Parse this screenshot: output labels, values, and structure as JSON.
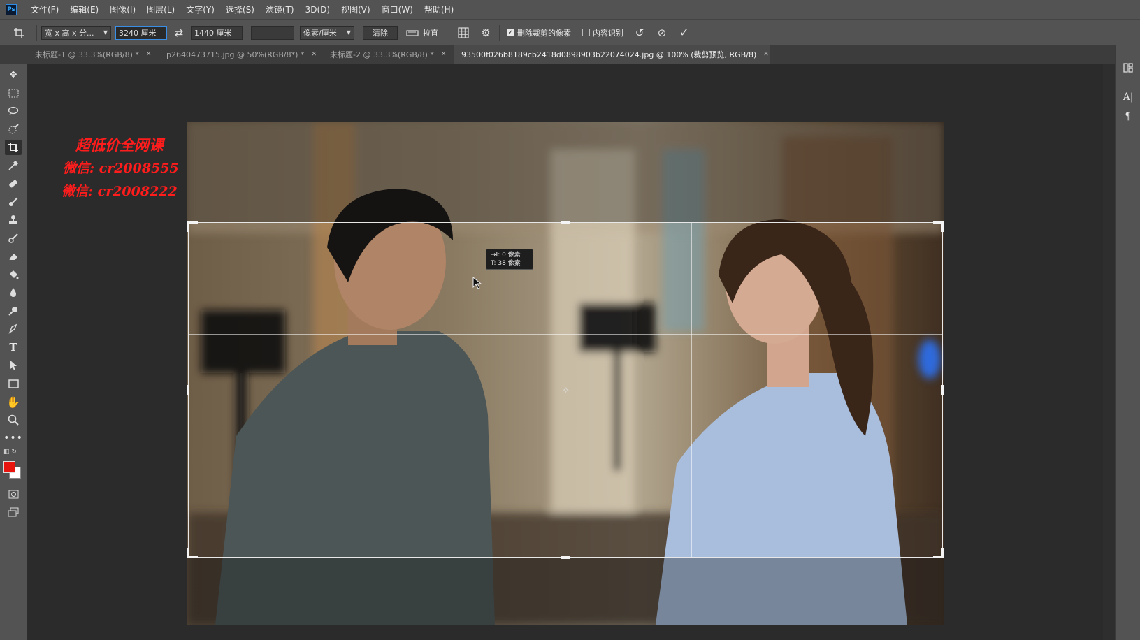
{
  "app": {
    "logo": "Ps"
  },
  "menu": [
    "文件(F)",
    "编辑(E)",
    "图像(I)",
    "图层(L)",
    "文字(Y)",
    "选择(S)",
    "滤镜(T)",
    "3D(D)",
    "视图(V)",
    "窗口(W)",
    "帮助(H)"
  ],
  "options": {
    "ratio_select": "宽 x 高 x 分...",
    "width_value": "3240 厘米",
    "height_value": "1440 厘米",
    "resolution_value": "",
    "unit_select": "像素/厘米",
    "clear_label": "清除",
    "straighten_label": "拉直",
    "delete_cropped_label": "删除裁剪的像素",
    "delete_cropped_checked": true,
    "content_aware_label": "内容识别",
    "content_aware_checked": false
  },
  "tabs": [
    {
      "label": "未标题-1 @ 33.3%(RGB/8) *",
      "active": false
    },
    {
      "label": "p2640473715.jpg @ 50%(RGB/8*) *",
      "active": false
    },
    {
      "label": "未标题-2 @ 33.3%(RGB/8) *",
      "active": false
    },
    {
      "label": "93500f026b8189cb2418d0898903b22074024.jpg @ 100% (裁剪预览, RGB/8)",
      "active": true
    }
  ],
  "crop_tooltip": {
    "line1": "→I: 0 像素",
    "line2": "T: 38 像素"
  },
  "watermark": {
    "line1": "超低价全网课",
    "line2": "微信: cr2008555",
    "line3": "微信: cr2008222"
  },
  "tools": [
    "move-tool-icon",
    "marquee-tool-icon",
    "lasso-tool-icon",
    "quick-select-tool-icon",
    "crop-tool-icon",
    "eyedropper-tool-icon",
    "healing-brush-tool-icon",
    "brush-tool-icon",
    "clone-stamp-tool-icon",
    "history-brush-tool-icon",
    "eraser-tool-icon",
    "paint-bucket-tool-icon",
    "blur-tool-icon",
    "dodge-tool-icon",
    "pen-tool-icon",
    "type-tool-icon",
    "path-select-tool-icon",
    "rectangle-tool-icon",
    "hand-tool-icon",
    "zoom-tool-icon",
    "more-tools-icon"
  ],
  "colors": {
    "foreground": "#e8150f",
    "background": "#ffffff",
    "accent": "#3a8ee6"
  }
}
